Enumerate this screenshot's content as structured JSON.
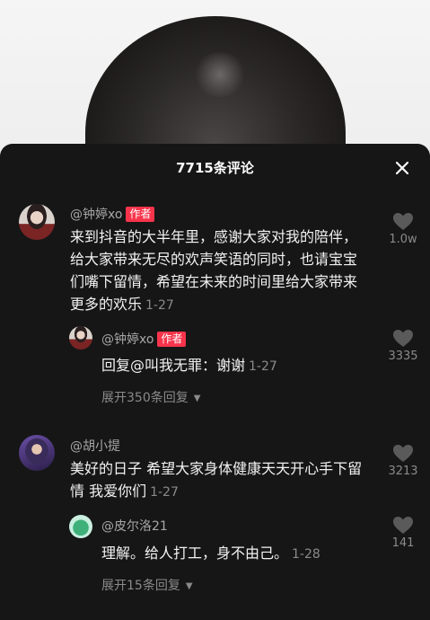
{
  "header": {
    "title": "7715条评论"
  },
  "comments": [
    {
      "author": "@钟婷xo",
      "tag": "作者",
      "text": "来到抖音的大半年里，感谢大家对我的陪伴，给大家带来无尽的欢声笑语的同时，也请宝宝们嘴下留情，希望在未来的时间里给大家带来更多的欢乐",
      "time": "1-27",
      "likes": "1.0w",
      "reply": {
        "author": "@钟婷xo",
        "tag": "作者",
        "text": "回复@叫我无罪：谢谢",
        "time": "1-27",
        "likes": "3335"
      },
      "expand": "展开350条回复"
    },
    {
      "author": "@胡小提",
      "text": "美好的日子 希望大家身体健康天天开心手下留情 我爱你们",
      "time": "1-27",
      "likes": "3213",
      "reply": {
        "author": "@皮尔洛21",
        "text": "理解。给人打工，身不由己。",
        "time": "1-28",
        "likes": "141"
      },
      "expand": "展开15条回复"
    }
  ],
  "icons": {
    "close": "close-icon",
    "like": "heart-icon",
    "caret": "caret-down-icon"
  },
  "colors": {
    "tag": "#f7344b",
    "sheet": "#161616",
    "muted": "#8a8a8a"
  }
}
